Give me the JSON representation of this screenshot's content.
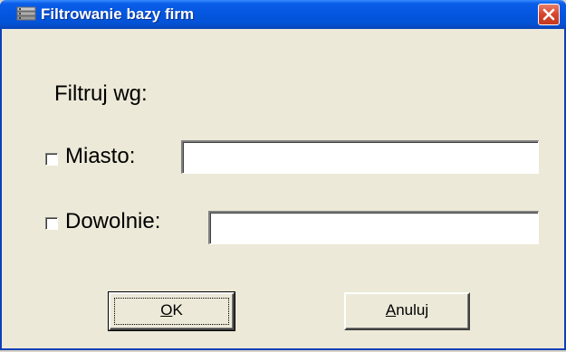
{
  "window": {
    "title": "Filtrowanie bazy firm",
    "app_icon": "database-icon",
    "close_icon": "close-icon",
    "accent": "#0556e0",
    "close_color": "#d6452b"
  },
  "form": {
    "heading": "Filtruj wg:",
    "miasto": {
      "label": "Miasto:",
      "checked": false,
      "value": ""
    },
    "dowolnie": {
      "label": "Dowolnie:",
      "checked": false,
      "value": ""
    }
  },
  "buttons": {
    "ok_mnemonic": "O",
    "ok_rest": "K",
    "cancel_mnemonic": "A",
    "cancel_rest": "nuluj"
  }
}
